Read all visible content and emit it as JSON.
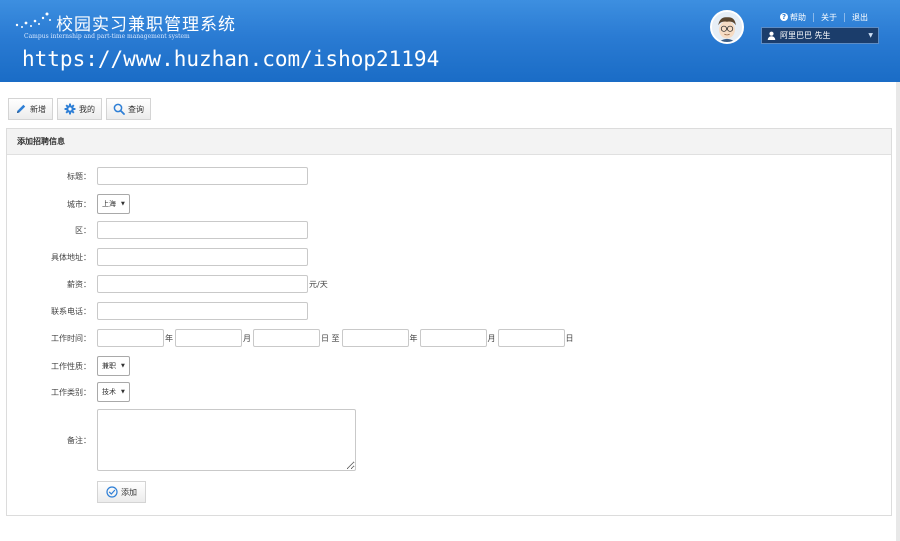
{
  "header": {
    "title": "校园实习兼职管理系统",
    "subtitle": "Campus internship and part-time management system",
    "watermark": "https://www.huzhan.com/ishop21194",
    "links": {
      "help": "帮助",
      "about": "关于",
      "logout": "退出"
    },
    "user": {
      "name": "阿里巴巴 先生"
    }
  },
  "toolbar": {
    "add": "新增",
    "mine": "我的",
    "search": "查询"
  },
  "panel": {
    "title": "添加招聘信息"
  },
  "form": {
    "title_label": "标题：",
    "city_label": "城市：",
    "city_value": "上海",
    "district_label": "区：",
    "address_label": "具体地址：",
    "salary_label": "薪资：",
    "salary_unit": "元/天",
    "phone_label": "联系电话：",
    "worktime_label": "工作时间：",
    "unit_year": "年",
    "unit_month": "月",
    "unit_day_to": "日 至",
    "unit_day": "日",
    "nature_label": "工作性质：",
    "nature_value": "兼职",
    "category_label": "工作类别：",
    "category_value": "技术",
    "remark_label": "备注：",
    "submit_label": "添加"
  },
  "colors": {
    "header_blue": "#2a7bd3",
    "icon_blue": "#2e7fd6"
  },
  "icons": {
    "add": "pencil-icon",
    "mine": "gear-icon",
    "search": "search-icon",
    "submit": "check-circle-icon",
    "help": "help-icon",
    "user": "user-icon",
    "avatar": "avatar"
  }
}
